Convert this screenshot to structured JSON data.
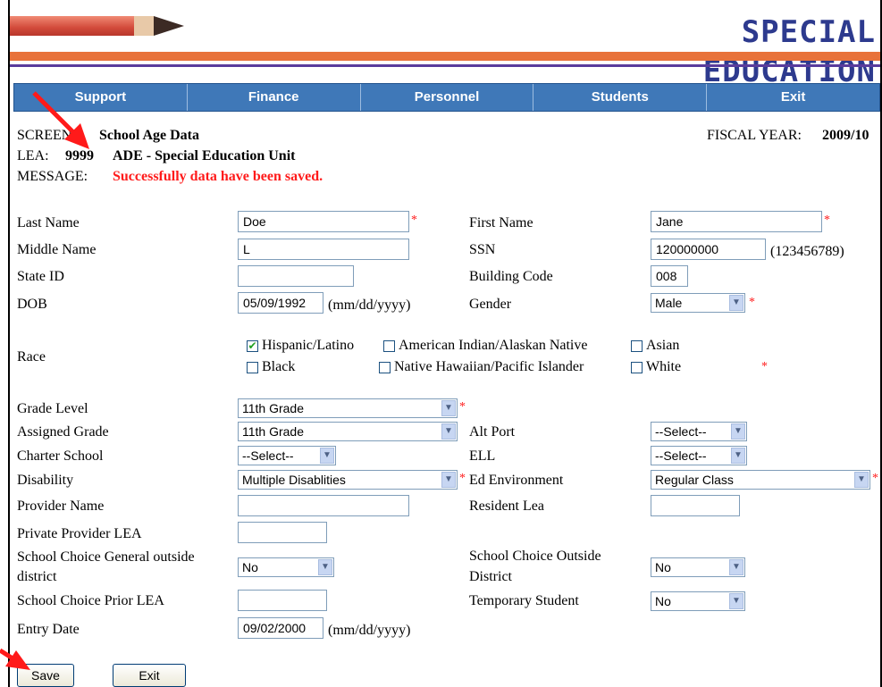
{
  "banner": {
    "title": "SPECIAL EDUCATION"
  },
  "nav": [
    "Support",
    "Finance",
    "Personnel",
    "Students",
    "Exit"
  ],
  "header": {
    "screen_label": "SCREEN:",
    "screen_value": "School Age Data",
    "fiscal_label": "FISCAL YEAR:",
    "fiscal_value": "2009/10",
    "lea_label": "LEA:",
    "lea_code": "9999",
    "lea_name": "ADE - Special Education Unit",
    "message_label": "MESSAGE:",
    "message_value": "Successfully data have been saved."
  },
  "form": {
    "last_name_label": "Last Name",
    "last_name": "Doe",
    "first_name_label": "First Name",
    "first_name": "Jane",
    "middle_name_label": "Middle Name",
    "middle_name": "L",
    "ssn_label": "SSN",
    "ssn": "120000000",
    "ssn_hint": "(123456789)",
    "state_id_label": "State ID",
    "state_id": "",
    "building_code_label": "Building Code",
    "building_code": "008",
    "dob_label": "DOB",
    "dob": "05/09/1992",
    "date_hint": "(mm/dd/yyyy)",
    "gender_label": "Gender",
    "gender": "Male",
    "race_label": "Race",
    "race_options": [
      {
        "label": "Hispanic/Latino",
        "checked": true
      },
      {
        "label": "American Indian/Alaskan Native",
        "checked": false
      },
      {
        "label": "Asian",
        "checked": false
      },
      {
        "label": "Black",
        "checked": false
      },
      {
        "label": "Native Hawaiian/Pacific Islander",
        "checked": false
      },
      {
        "label": "White",
        "checked": false
      }
    ],
    "grade_level_label": "Grade Level",
    "grade_level": "11th Grade",
    "assigned_grade_label": "Assigned Grade",
    "assigned_grade": "11th Grade",
    "alt_port_label": "Alt Port",
    "alt_port": "--Select--",
    "charter_school_label": "Charter School",
    "charter_school": "--Select--",
    "ell_label": "ELL",
    "ell": "--Select--",
    "disability_label": "Disability",
    "disability": "Multiple Disablities",
    "ed_env_label": "Ed Environment",
    "ed_env": "Regular Class",
    "provider_name_label": "Provider Name",
    "provider_name": "",
    "resident_lea_label": "Resident Lea",
    "resident_lea": "",
    "private_provider_label": "Private Provider LEA",
    "private_provider": "",
    "choice_general_label_1": "School Choice General outside",
    "choice_general_label_2": "district",
    "choice_general": "No",
    "choice_outside_label_1": "School Choice Outside",
    "choice_outside_label_2": "District",
    "choice_outside": "No",
    "choice_prior_label": "School Choice Prior LEA",
    "choice_prior": "",
    "temp_student_label": "Temporary Student",
    "temp_student": "No",
    "entry_date_label": "Entry Date",
    "entry_date": "09/02/2000",
    "required_mark": "*"
  },
  "buttons": {
    "save": "Save",
    "exit": "Exit"
  },
  "colors": {
    "nav_bg": "#3f78b8",
    "accent_red": "#ff1a1a",
    "banner_blue": "#2d3a8e",
    "orange": "#e8723a"
  }
}
